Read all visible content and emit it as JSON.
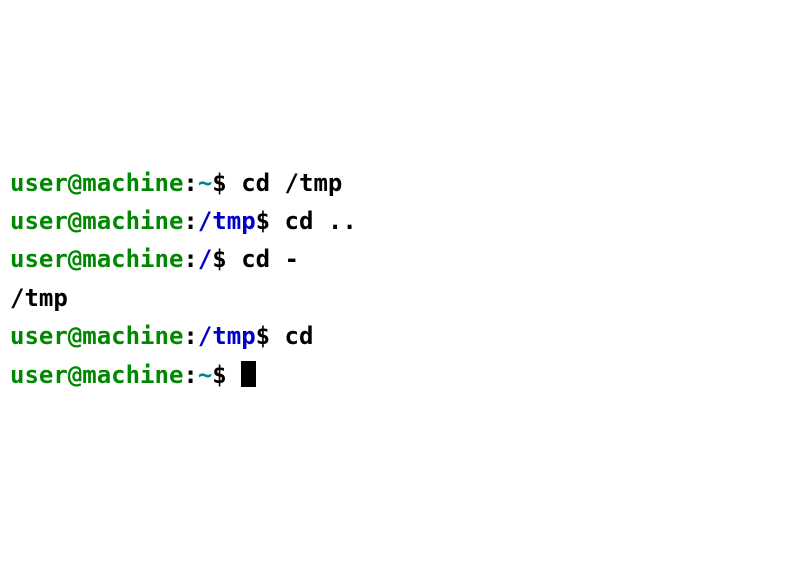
{
  "lines": [
    {
      "user_host": "user@machine",
      "colon": ":",
      "tilde": "~",
      "path": "",
      "dollar": "$ ",
      "command": "cd /tmp",
      "output": ""
    },
    {
      "user_host": "user@machine",
      "colon": ":",
      "tilde": "",
      "path": "/tmp",
      "dollar": "$ ",
      "command": "cd ..",
      "output": ""
    },
    {
      "user_host": "user@machine",
      "colon": ":",
      "tilde": "",
      "path": "/",
      "dollar": "$ ",
      "command": "cd -",
      "output": ""
    },
    {
      "output": "/tmp"
    },
    {
      "user_host": "user@machine",
      "colon": ":",
      "tilde": "",
      "path": "/tmp",
      "dollar": "$ ",
      "command": "cd",
      "output": ""
    },
    {
      "user_host": "user@machine",
      "colon": ":",
      "tilde": "~",
      "path": "",
      "dollar": "$ ",
      "command": "",
      "output": "",
      "cursor": true
    }
  ]
}
